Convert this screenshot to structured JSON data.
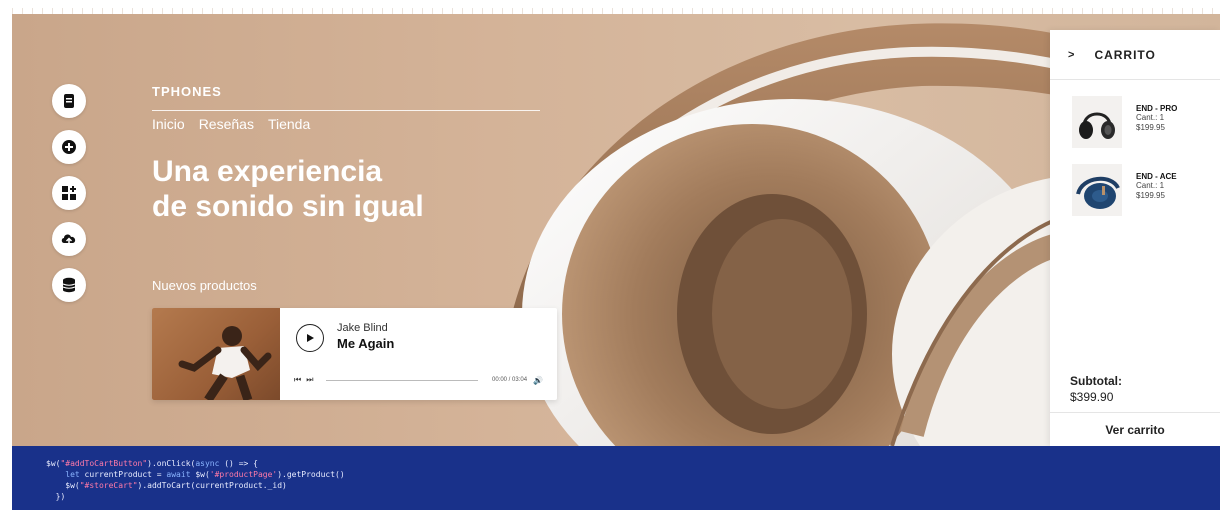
{
  "brand": {
    "name": "TPHONES"
  },
  "nav": {
    "items": [
      {
        "label": "Inicio"
      },
      {
        "label": "Reseñas"
      },
      {
        "label": "Tienda"
      }
    ]
  },
  "hero": {
    "headline_line1": "Una experiencia",
    "headline_line2": "de sonido sin igual",
    "section_label": "Nuevos productos"
  },
  "rail": {
    "icons": [
      "page-icon",
      "add-icon",
      "apps-icon",
      "upload-icon",
      "database-icon"
    ]
  },
  "player": {
    "artist": "Jake Blind",
    "track": "Me Again",
    "prev_glyph": "⏮",
    "next_glyph": "⏭",
    "time": "00:00 / 03:04",
    "volume_glyph": "🔊",
    "progress": 0
  },
  "cart": {
    "close_glyph": ">",
    "title": "CARRITO",
    "items": [
      {
        "name": "END - PRO",
        "qty": "Cant.: 1",
        "price": "$199.95"
      },
      {
        "name": "END - ACE",
        "qty": "Cant.: 1",
        "price": "$199.95"
      }
    ],
    "subtotal_label": "Subtotal:",
    "subtotal_value": "$399.90",
    "view_cart_label": "Ver carrito"
  },
  "code": {
    "line1_a": "$w(",
    "line1_s": "\"#addToCartButton\"",
    "line1_b": ").onClick(",
    "line1_k": "async",
    "line1_c": " () => {",
    "line2_a": "    ",
    "line2_k1": "let",
    "line2_b": " currentProduct = ",
    "line2_k2": "await",
    "line2_c": " $w(",
    "line2_s": "'#productPage'",
    "line2_d": ").getProduct()",
    "line3_a": "    $w(",
    "line3_s": "\"#storeCart\"",
    "line3_b": ").addToCart(currentProduct._id)",
    "line4": "  })"
  },
  "colors": {
    "hero_bg": "#d4b398",
    "code_bg": "#19318a",
    "headphone_tan": "#a57f5f",
    "headphone_white": "#f4f2f0"
  }
}
